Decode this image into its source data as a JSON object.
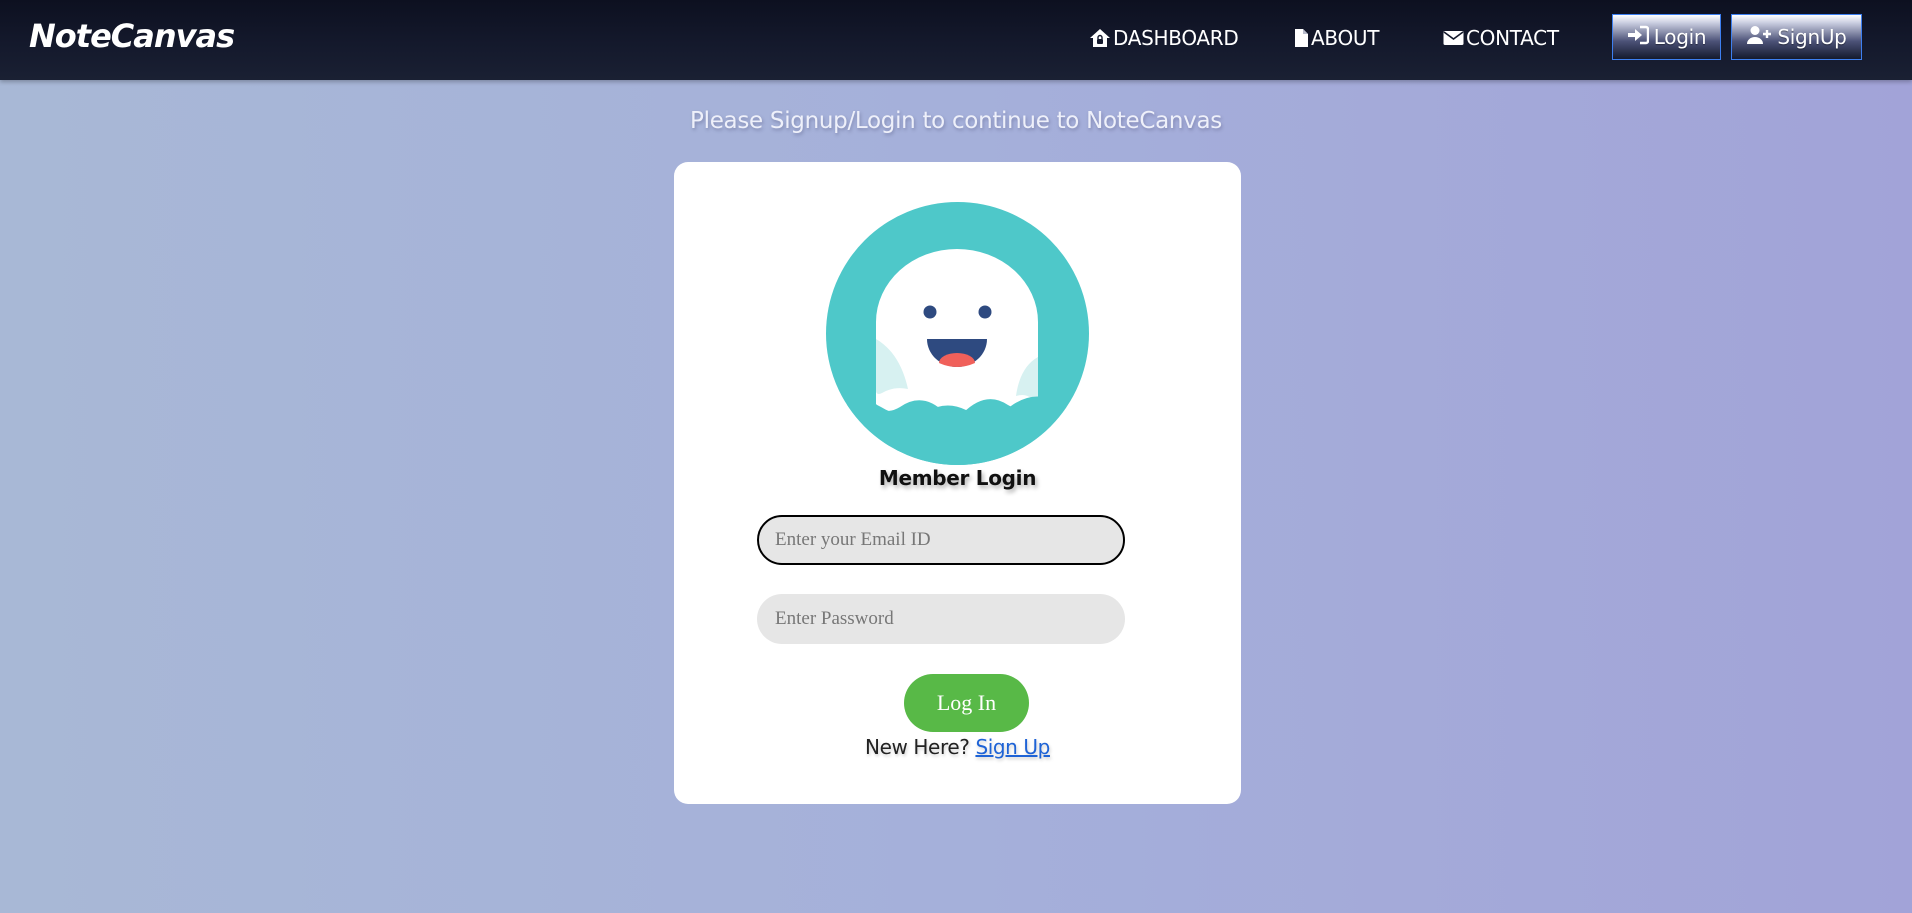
{
  "navbar": {
    "brand": "NoteCanvas",
    "links": [
      {
        "label": "DASHBOARD",
        "icon": "home-lock-icon"
      },
      {
        "label": "ABOUT",
        "icon": "document-icon"
      },
      {
        "label": "CONTACT",
        "icon": "envelope-icon"
      }
    ],
    "login_button": {
      "label": "Login",
      "icon": "sign-in-icon"
    },
    "signup_button": {
      "label": "SignUp",
      "icon": "user-plus-icon"
    }
  },
  "subtitle": "Please Signup/Login to continue to NoteCanvas",
  "card": {
    "avatar": "ghost-avatar",
    "title": "Member Login",
    "email_placeholder": "Enter your Email ID",
    "email_value": "",
    "password_placeholder": "Enter Password",
    "password_value": "",
    "submit_label": "Log In",
    "new_here_text": "New Here?",
    "signup_link": "Sign Up"
  },
  "colors": {
    "accent_green": "#58b947",
    "avatar_teal": "#4ec8c9",
    "link_blue": "#1e63d6",
    "navbar_dark": "#14192c"
  }
}
